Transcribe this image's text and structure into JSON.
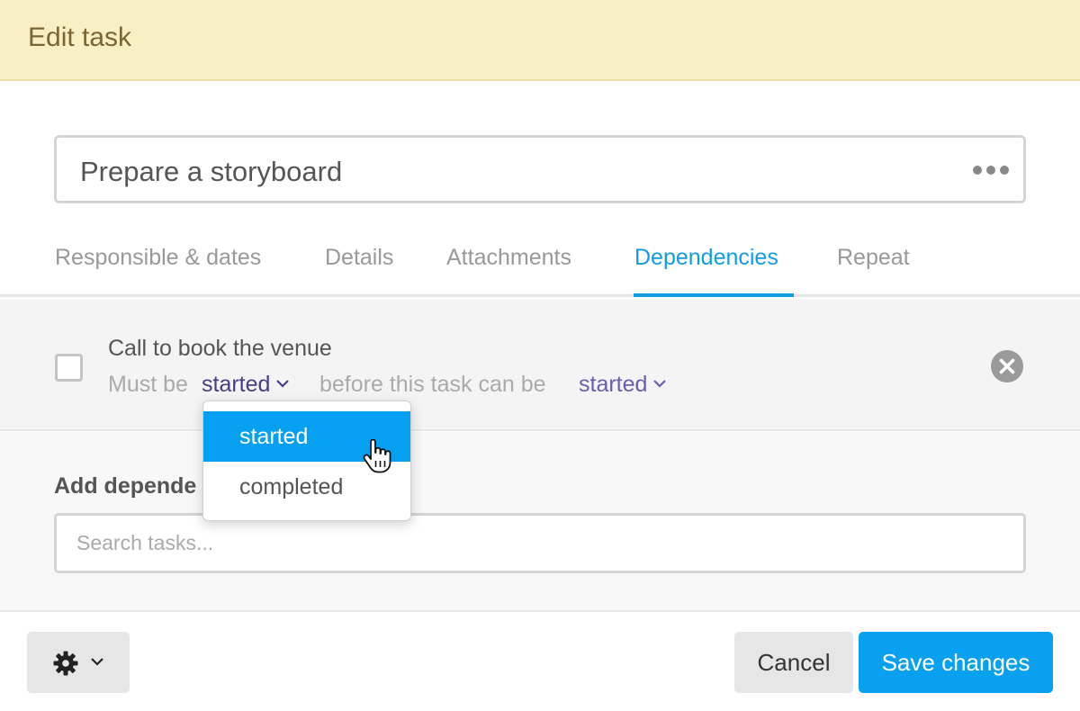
{
  "header": {
    "title": "Edit task"
  },
  "task": {
    "name": "Prepare a storyboard"
  },
  "tabs": [
    {
      "label": "Responsible & dates"
    },
    {
      "label": "Details"
    },
    {
      "label": "Attachments"
    },
    {
      "label": "Dependencies",
      "active": true
    },
    {
      "label": "Repeat"
    }
  ],
  "dependency": {
    "task_title": "Call to book the venue",
    "prefix": "Must be",
    "middle": "before this task can be",
    "first_state": "started",
    "second_state": "started"
  },
  "dropdown": {
    "options": [
      "started",
      "completed"
    ],
    "highlighted": "started"
  },
  "add_dependency": {
    "label": "Add depende",
    "search_placeholder": "Search tasks..."
  },
  "footer": {
    "cancel_label": "Cancel",
    "save_label": "Save changes"
  },
  "colors": {
    "header_bg": "#f8f0c4",
    "header_text": "#7a6533",
    "accent": "#139ce6",
    "save_button": "#0aa0f0",
    "state_link": "#5b4b9e"
  },
  "icons": {
    "more": "more-horizontal-icon",
    "remove": "close-circle-icon",
    "dropdown_chevron": "chevron-down-icon",
    "settings": "gear-icon",
    "cursor": "hand-pointer-icon"
  }
}
